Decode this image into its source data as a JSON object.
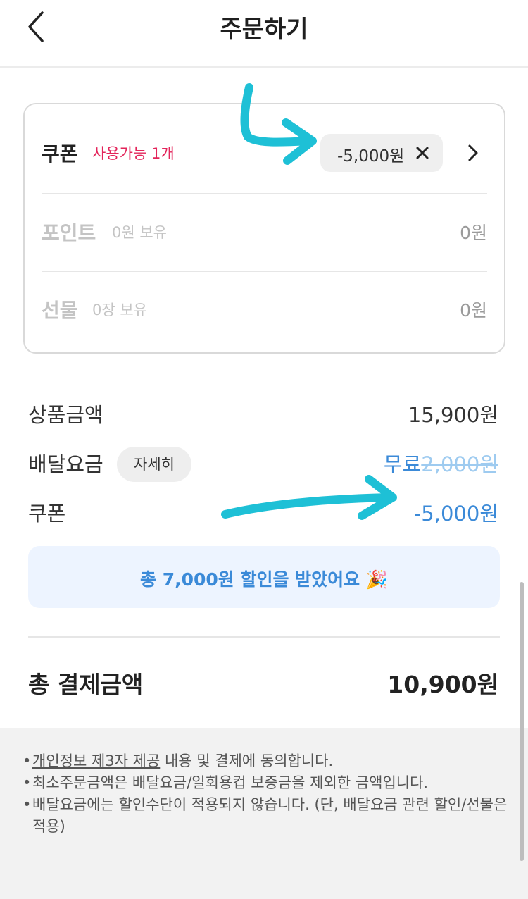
{
  "header": {
    "title": "주문하기"
  },
  "discounts": {
    "coupon": {
      "label": "쿠폰",
      "available": "사용가능 1개",
      "applied_amount": "-5,000원"
    },
    "points": {
      "label": "포인트",
      "holding": "0원 보유",
      "value": "0원"
    },
    "gift": {
      "label": "선물",
      "holding": "0장 보유",
      "value": "0원"
    }
  },
  "summary": {
    "product_label": "상품금액",
    "product_value": "15,900원",
    "delivery_label": "배달요금",
    "delivery_detail_button": "자세히",
    "delivery_free": "무료",
    "delivery_original": "2,000원",
    "coupon_label": "쿠폰",
    "coupon_value": "-5,000원"
  },
  "banner": {
    "text": "총 7,000원 할인을 받았어요 🎉"
  },
  "total": {
    "label": "총 결제금액",
    "value": "10,900원"
  },
  "notices": {
    "item1_link": "개인정보 제3자 제공",
    "item1_rest": " 내용 및 결제에 동의합니다.",
    "item2": "최소주문금액은 배달요금/일회용컵 보증금을 제외한 금액입니다.",
    "item3": "배달요금에는 할인수단이 적용되지 않습니다. (단, 배달요금 관련 할인/선물은 적용)"
  },
  "colors": {
    "accent_blue": "#3b8ad8",
    "available_red": "#e3245a",
    "annotation_cyan": "#1ec0d6",
    "banner_bg": "#edf4ff"
  },
  "icons": [
    "back-arrow-icon",
    "close-icon",
    "chevron-right-icon",
    "party-popper-icon"
  ]
}
